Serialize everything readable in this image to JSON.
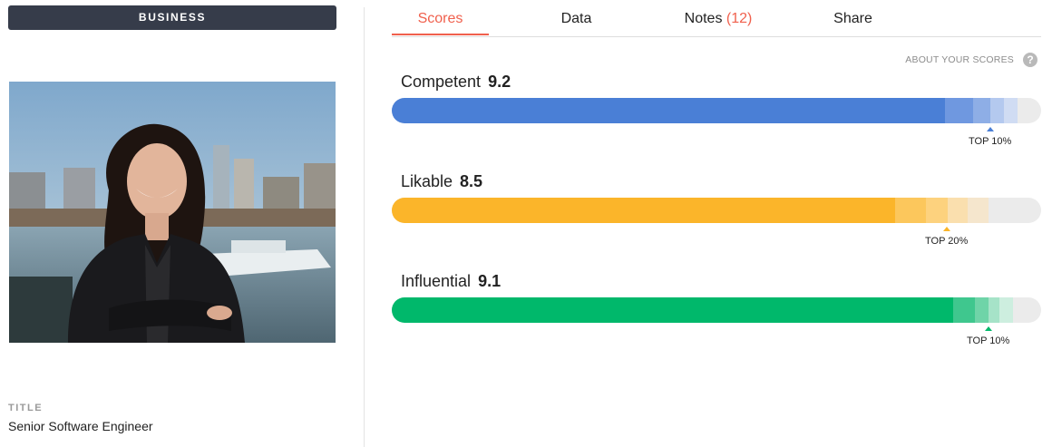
{
  "category_badge": "BUSINESS",
  "photo": {
    "alt": "person-photo"
  },
  "profile": {
    "title_label": "TITLE",
    "title_value": "Senior Software Engineer"
  },
  "tabs": [
    {
      "label": "Scores",
      "active": true
    },
    {
      "label": "Data",
      "active": false
    },
    {
      "label": "Notes",
      "count": "(12)",
      "active": false
    },
    {
      "label": "Share",
      "active": false
    }
  ],
  "about_scores": "ABOUT YOUR SCORES",
  "help_icon": "?",
  "scores": [
    {
      "name": "Competent",
      "value": "9.2",
      "rank_label": "TOP 10%",
      "color": "#4a7fd6",
      "tint_colors": [
        "#6f98e0",
        "#8eaee6",
        "#b4c9ef",
        "#d0dcf3"
      ]
    },
    {
      "name": "Likable",
      "value": "8.5",
      "rank_label": "TOP 20%",
      "color": "#fbb52a",
      "tint_colors": [
        "#fcc75c",
        "#fdd27e",
        "#fadfae",
        "#f5e6cd"
      ]
    },
    {
      "name": "Influential",
      "value": "9.1",
      "rank_label": "TOP 10%",
      "color": "#00b86b",
      "tint_colors": [
        "#3fc78e",
        "#6fd4a8",
        "#a6e3c8",
        "#cdeedf"
      ]
    }
  ]
}
